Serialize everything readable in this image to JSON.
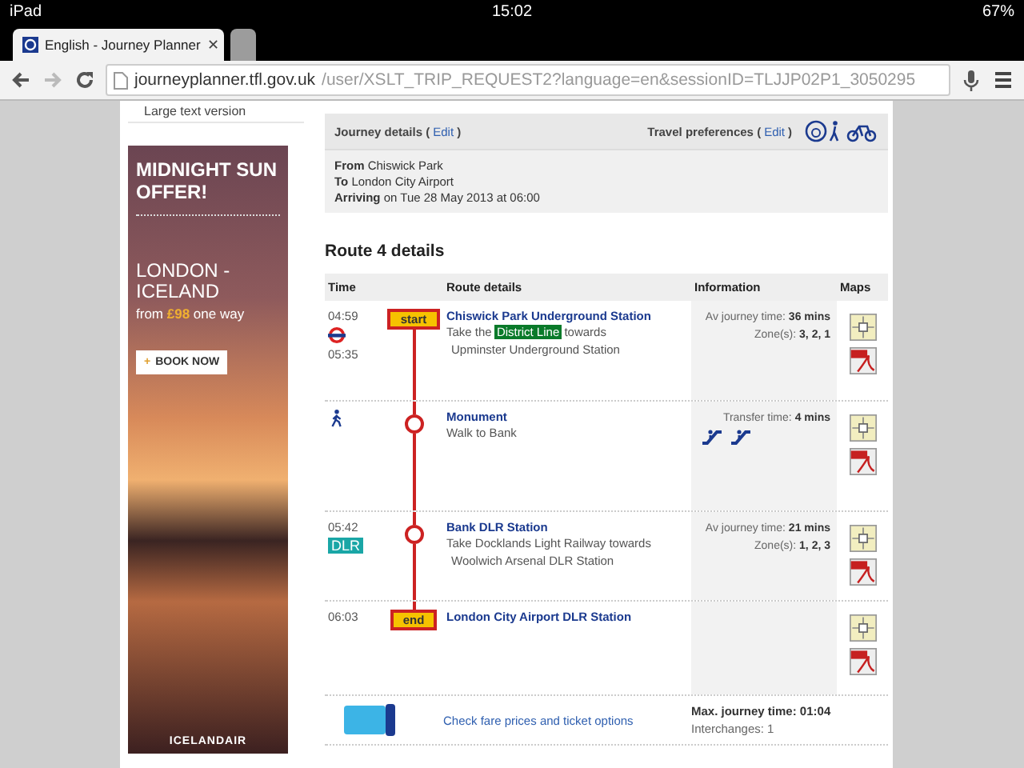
{
  "status_bar": {
    "device": "iPad",
    "time": "15:02",
    "battery": "67%"
  },
  "browser": {
    "tabs": [
      {
        "title": "English - Journey Planner",
        "close": "✕",
        "selected": true
      },
      {
        "selected": false
      }
    ],
    "url_host": "journeyplanner.tfl.gov.uk",
    "url_path": "/user/XSLT_TRIP_REQUEST2?language=en&sessionID=TLJJP02P1_3050295"
  },
  "sidebar": {
    "links": [
      "Large text version"
    ],
    "ad": {
      "headline": "MIDNIGHT SUN OFFER!",
      "destination": "LONDON - ICELAND",
      "price_before": "from ",
      "price": "£98",
      "price_after": " one way",
      "button_icon": "+",
      "button": "BOOK NOW",
      "brand": "ICELANDAIR"
    }
  },
  "journey": {
    "headers": [
      {
        "label": "Journey details",
        "open": "(",
        "edit": "Edit",
        "close": ")"
      },
      {
        "label": "Travel preferences",
        "open": "(",
        "edit": "Edit",
        "close": ")"
      }
    ],
    "summary": [
      {
        "label": "From",
        "value": "Chiswick Park"
      },
      {
        "label": "To",
        "value": "London City Airport"
      },
      {
        "label": "Arriving",
        "value": "on Tue 28 May 2013 at 06:00"
      }
    ]
  },
  "route": {
    "title": "Route 4 details",
    "columns": [
      "Time",
      "Route details",
      "Information",
      "Maps"
    ],
    "legs": [
      {
        "kind": "start",
        "times": [
          "04:59",
          "05:35"
        ],
        "mode_icon": {
          "kind": "underground"
        },
        "marker_label": "start",
        "station": "Chiswick Park Underground Station",
        "description": [
          {
            "text": "Take the "
          },
          {
            "text": "District Line",
            "kind": "line"
          },
          {
            "text": " towards"
          },
          {
            "text": "Upminster Underground Station",
            "kind": "break"
          }
        ],
        "info": [
          {
            "label": "Av journey time: ",
            "value": "36 mins"
          },
          {
            "label": "Zone(s): ",
            "value": "3, 2, 1"
          }
        ]
      },
      {
        "kind": "stop",
        "mode_icon": {
          "kind": "walk"
        },
        "station": "Monument",
        "description": [
          {
            "text": "Walk to Bank"
          }
        ],
        "info": [
          {
            "label": "Transfer time: ",
            "value": "4 mins"
          }
        ],
        "info_icons": [
          {
            "kind": "escalator"
          },
          {
            "kind": "escalator"
          }
        ]
      },
      {
        "kind": "stop",
        "times": [
          "05:42"
        ],
        "mode_icon": {
          "kind": "dlr",
          "label": "DLR"
        },
        "station": "Bank DLR Station",
        "description": [
          {
            "text": "Take Docklands Light Railway towards"
          },
          {
            "text": "Woolwich Arsenal DLR Station",
            "kind": "break"
          }
        ],
        "info": [
          {
            "label": "Av journey time: ",
            "value": "21 mins"
          },
          {
            "label": "Zone(s): ",
            "value": "1, 2, 3"
          }
        ]
      },
      {
        "kind": "end",
        "times": [
          "06:03"
        ],
        "marker_label": "end",
        "station": "London City Airport DLR Station"
      }
    ],
    "footer": {
      "fares_link": "Check fare prices and ticket options",
      "max_time": "Max. journey time: 01:04",
      "interchanges": "Interchanges: 1"
    }
  }
}
